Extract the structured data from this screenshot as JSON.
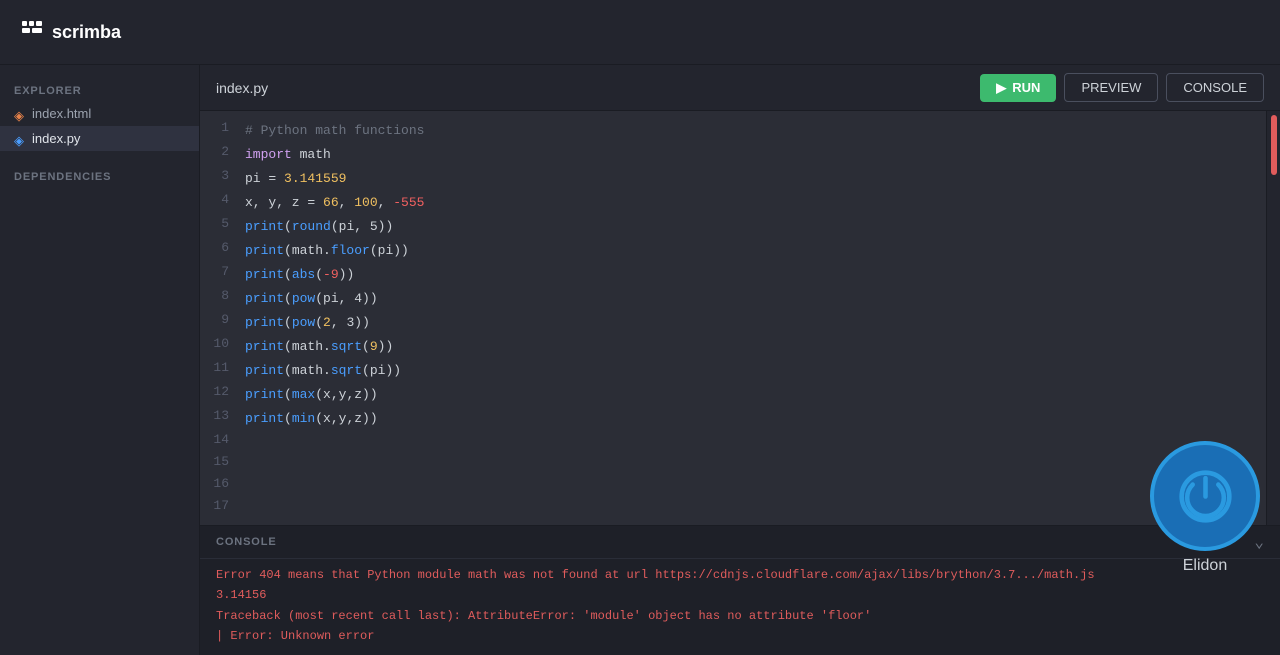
{
  "header": {
    "logo_icon": "⠿",
    "logo_text": "scrimba"
  },
  "sidebar": {
    "explorer_label": "EXPLORER",
    "files": [
      {
        "name": "index.html",
        "icon": "html",
        "active": false
      },
      {
        "name": "index.py",
        "icon": "py",
        "active": true
      }
    ],
    "dependencies_label": "DEPENDENCIES"
  },
  "editor": {
    "filename": "index.py",
    "run_label": "RUN",
    "preview_label": "PREVIEW",
    "console_label": "CONSOLE",
    "lines": [
      {
        "num": "1",
        "tokens": [
          {
            "t": "# Python math functions",
            "c": "c-comment"
          }
        ]
      },
      {
        "num": "2",
        "tokens": [
          {
            "t": "import",
            "c": "c-keyword"
          },
          {
            "t": " math",
            "c": "c-plain"
          }
        ]
      },
      {
        "num": "3",
        "tokens": [
          {
            "t": "pi = ",
            "c": "c-plain"
          },
          {
            "t": "3.141559",
            "c": "c-number"
          }
        ]
      },
      {
        "num": "4",
        "tokens": [
          {
            "t": "x, y, z = ",
            "c": "c-plain"
          },
          {
            "t": "66",
            "c": "c-number"
          },
          {
            "t": ", ",
            "c": "c-plain"
          },
          {
            "t": "100",
            "c": "c-number"
          },
          {
            "t": ", ",
            "c": "c-plain"
          },
          {
            "t": "-555",
            "c": "c-number-neg"
          }
        ]
      },
      {
        "num": "5",
        "tokens": [
          {
            "t": "print",
            "c": "c-builtin"
          },
          {
            "t": "(",
            "c": "c-plain"
          },
          {
            "t": "round",
            "c": "c-builtin"
          },
          {
            "t": "(pi, 5))",
            "c": "c-plain"
          }
        ]
      },
      {
        "num": "6",
        "tokens": [
          {
            "t": "print",
            "c": "c-builtin"
          },
          {
            "t": "(math.",
            "c": "c-plain"
          },
          {
            "t": "floor",
            "c": "c-builtin"
          },
          {
            "t": "(pi))",
            "c": "c-plain"
          }
        ]
      },
      {
        "num": "7",
        "tokens": [
          {
            "t": "print",
            "c": "c-builtin"
          },
          {
            "t": "(",
            "c": "c-plain"
          },
          {
            "t": "abs",
            "c": "c-builtin"
          },
          {
            "t": "(",
            "c": "c-plain"
          },
          {
            "t": "-9",
            "c": "c-number-neg"
          },
          {
            "t": "))",
            "c": "c-plain"
          }
        ]
      },
      {
        "num": "8",
        "tokens": [
          {
            "t": "print",
            "c": "c-builtin"
          },
          {
            "t": "(",
            "c": "c-plain"
          },
          {
            "t": "pow",
            "c": "c-builtin"
          },
          {
            "t": "(pi, 4))",
            "c": "c-plain"
          }
        ]
      },
      {
        "num": "9",
        "tokens": [
          {
            "t": "print",
            "c": "c-builtin"
          },
          {
            "t": "(",
            "c": "c-plain"
          },
          {
            "t": "pow",
            "c": "c-builtin"
          },
          {
            "t": "(",
            "c": "c-plain"
          },
          {
            "t": "2",
            "c": "c-number"
          },
          {
            "t": ", 3))",
            "c": "c-plain"
          }
        ]
      },
      {
        "num": "10",
        "tokens": [
          {
            "t": "print",
            "c": "c-builtin"
          },
          {
            "t": "(math.",
            "c": "c-plain"
          },
          {
            "t": "sqrt",
            "c": "c-builtin"
          },
          {
            "t": "(",
            "c": "c-plain"
          },
          {
            "t": "9",
            "c": "c-number"
          },
          {
            "t": "))",
            "c": "c-plain"
          }
        ]
      },
      {
        "num": "11",
        "tokens": [
          {
            "t": "print",
            "c": "c-builtin"
          },
          {
            "t": "(math.",
            "c": "c-plain"
          },
          {
            "t": "sqrt",
            "c": "c-builtin"
          },
          {
            "t": "(pi))",
            "c": "c-plain"
          }
        ]
      },
      {
        "num": "12",
        "tokens": [
          {
            "t": "print",
            "c": "c-builtin"
          },
          {
            "t": "(",
            "c": "c-plain"
          },
          {
            "t": "max",
            "c": "c-builtin"
          },
          {
            "t": "(x,y,z))",
            "c": "c-plain"
          }
        ]
      },
      {
        "num": "13",
        "tokens": [
          {
            "t": "print",
            "c": "c-builtin"
          },
          {
            "t": "(",
            "c": "c-plain"
          },
          {
            "t": "min",
            "c": "c-builtin"
          },
          {
            "t": "(x,y,z))",
            "c": "c-plain"
          }
        ]
      },
      {
        "num": "14",
        "tokens": []
      },
      {
        "num": "15",
        "tokens": []
      },
      {
        "num": "16",
        "tokens": []
      },
      {
        "num": "17",
        "tokens": []
      }
    ]
  },
  "console": {
    "label": "CONSOLE",
    "chevron": "⌄",
    "output": [
      "Error 404 means that Python module math was not found at url https://cdnjs.cloudflare.com/ajax/libs/brython/3.7.../math.js",
      "3.14156",
      "Traceback (most recent call last): AttributeError: 'module' object has no attribute 'floor'",
      "| Error: Unknown error"
    ]
  },
  "avatar": {
    "name": "Elidon"
  }
}
